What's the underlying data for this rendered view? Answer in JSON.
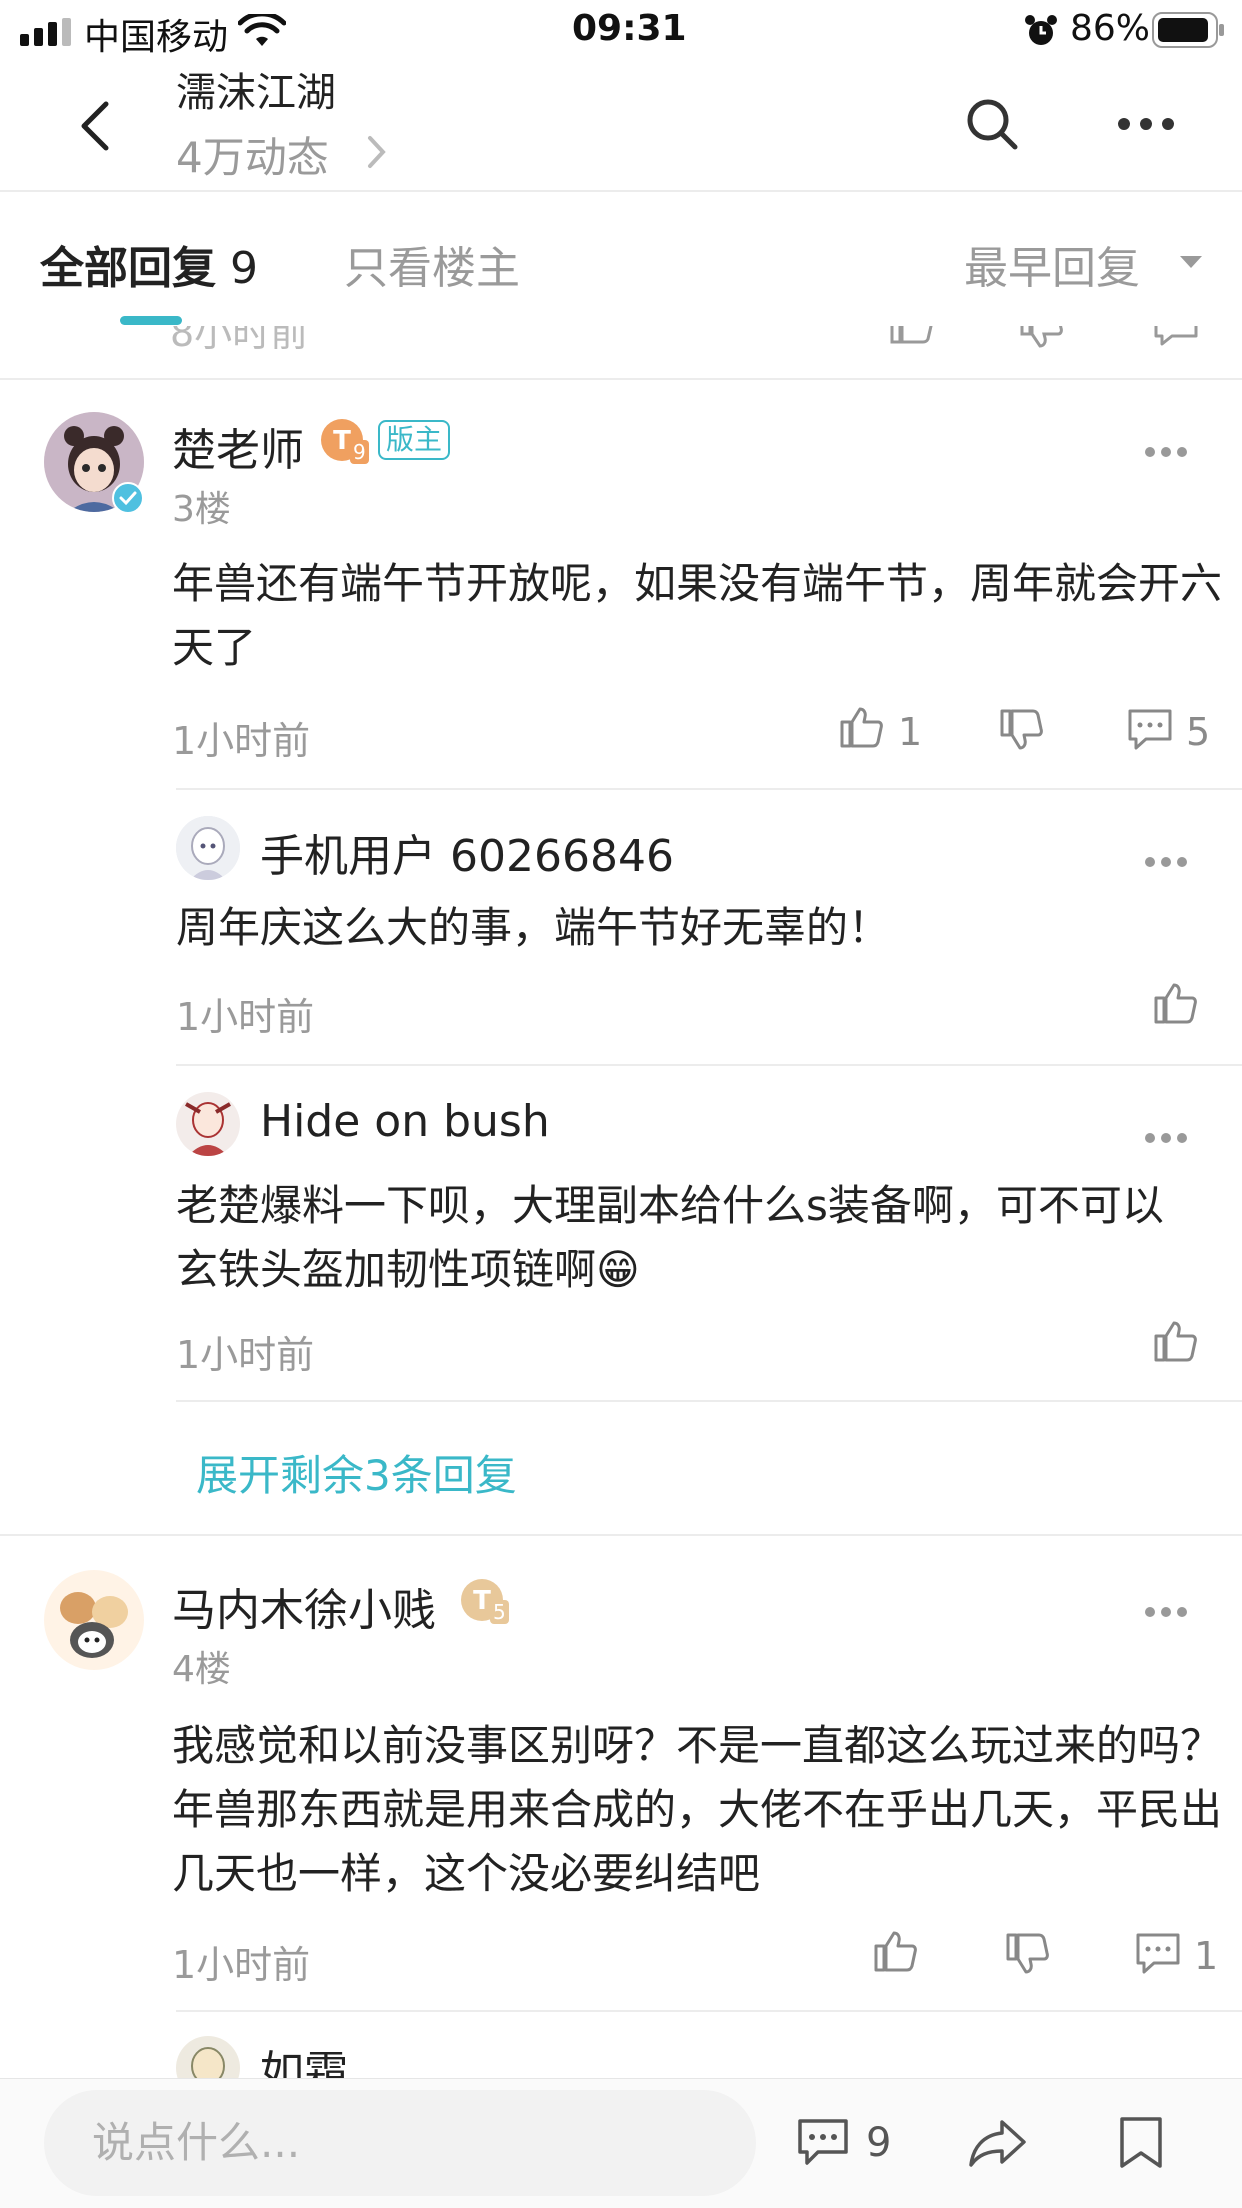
{
  "status_bar": {
    "carrier": "中国移动",
    "time": "09:31",
    "battery": "86%"
  },
  "header": {
    "title": "濡沫江湖",
    "subtitle": "4万动态"
  },
  "tabs": {
    "all_label": "全部回复",
    "all_count": "9",
    "op_only_label": "只看楼主",
    "sort_label": "最早回复"
  },
  "posts": [
    {
      "username": "楚老师",
      "badge": "版主",
      "level": "9",
      "floor": "3楼",
      "content": "年兽还有端午节开放呢，如果没有端午节，周年就会开六天了",
      "time": "1小时前",
      "likes": "1",
      "comments": "5",
      "replies": [
        {
          "username": "手机用户 60266846",
          "content": "周年庆这么大的事，端午节好无辜的！",
          "time": "1小时前"
        },
        {
          "username": "Hide on bush",
          "content": "老楚爆料一下呗，大理副本给什么s装备啊，可不可以玄铁头盔加韧性项链啊😁",
          "time": "1小时前"
        }
      ],
      "expand_label": "展开剩余3条回复"
    },
    {
      "username": "马内木徐小贱",
      "level": "5",
      "floor": "4楼",
      "content": "我感觉和以前没事区别呀？不是一直都这么玩过来的吗？年兽那东西就是用来合成的，大佬不在乎出几天，平民出几天也一样，这个没必要纠结吧",
      "time": "1小时前",
      "comments": "1",
      "replies": [
        {
          "username": "如霜"
        }
      ]
    }
  ],
  "bottom_bar": {
    "input_placeholder": "说点什么...",
    "comment_count": "9"
  },
  "colors": {
    "accent": "#3ab8c8",
    "badge_orange": "#f0a060",
    "verified": "#4fc0e0"
  }
}
